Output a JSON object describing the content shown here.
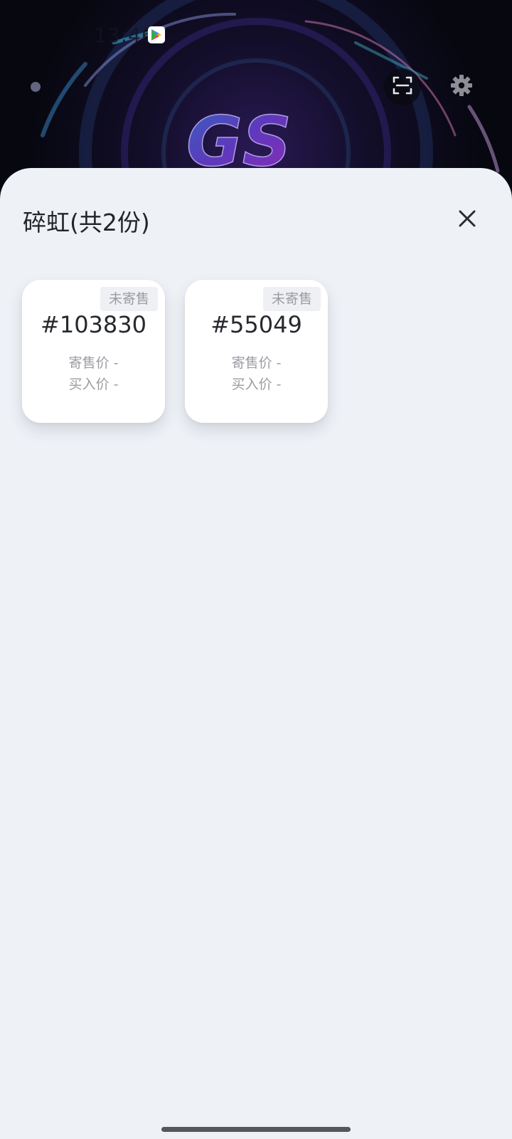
{
  "status_bar": {
    "time": "13:46",
    "app_icon": "play-store-icon"
  },
  "header": {
    "scan_icon": "scan-icon",
    "settings_icon": "gear-icon"
  },
  "sheet": {
    "title": "碎虹(共2份)",
    "close_icon": "close-icon",
    "items": [
      {
        "number": "#103830",
        "status": "未寄售",
        "sale_price_label": "寄售价",
        "sale_price_value": "-",
        "buy_price_label": "买入价",
        "buy_price_value": "-"
      },
      {
        "number": "#55049",
        "status": "未寄售",
        "sale_price_label": "寄售价",
        "sale_price_value": "-",
        "buy_price_label": "买入价",
        "buy_price_value": "-"
      }
    ]
  },
  "colors": {
    "sheet_background": "#eef1f6",
    "card_background": "#ffffff",
    "primary_text": "#222428",
    "muted_text": "#9a9ca2"
  }
}
